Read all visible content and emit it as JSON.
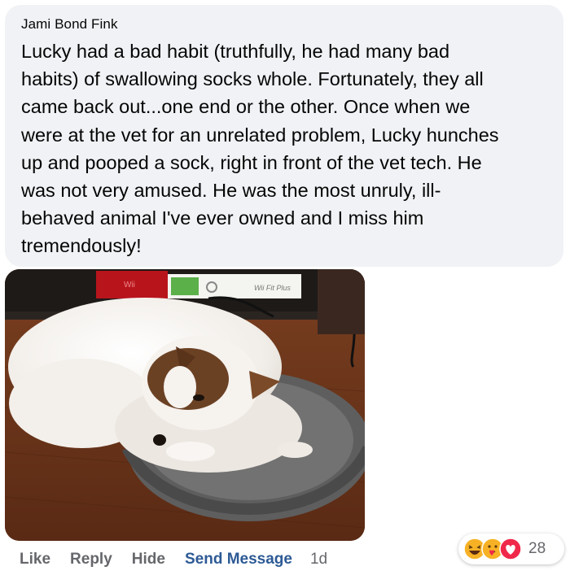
{
  "comment": {
    "author": "Jami Bond Fink",
    "lines": [
      "Lucky had a bad habit (truthfully, he had many bad",
      "habits) of swallowing socks whole. Fortunately, they all",
      "came back out...one end or the other. Once when we",
      "were at the vet for an unrelated problem, Lucky hunches",
      "up and pooped a sock, right in front of the vet tech. He",
      "was not very amused. He was the most unruly, ill-",
      "behaved animal I've ever owned and I miss him",
      "tremendously!"
    ]
  },
  "photo": {
    "box_labels": [
      "Wii",
      "Wii Fit Plus"
    ]
  },
  "actions": {
    "like": "Like",
    "reply": "Reply",
    "hide": "Hide",
    "send_message": "Send Message",
    "time": "1d"
  },
  "reactions": {
    "icons": [
      "laughing-face-icon",
      "care-face-icon",
      "love-heart-icon"
    ],
    "count": "28"
  },
  "colors": {
    "bubble": "#f0f2f5",
    "action_text": "#65676b",
    "send_message": "#2d5a95",
    "love": "#f0284a",
    "haha": "#f7b125"
  }
}
